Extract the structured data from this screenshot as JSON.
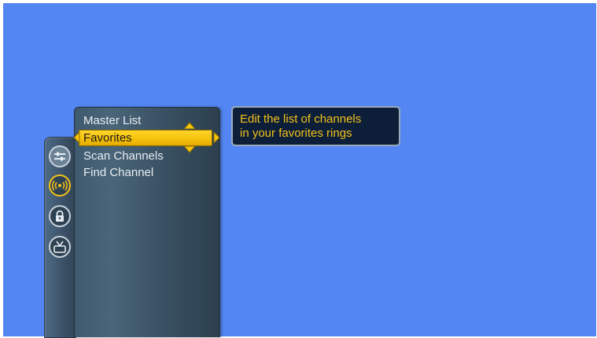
{
  "menu": {
    "items": [
      {
        "label": "Master List",
        "selected": false
      },
      {
        "label": "Favorites",
        "selected": true
      },
      {
        "label": "Scan Channels",
        "selected": false
      },
      {
        "label": "Find Channel",
        "selected": false
      }
    ]
  },
  "rail": {
    "icons": [
      {
        "name": "settings-sliders-icon",
        "active": false
      },
      {
        "name": "broadcast-icon",
        "active": true
      },
      {
        "name": "lock-icon",
        "active": false
      },
      {
        "name": "antenna-tv-icon",
        "active": false
      }
    ]
  },
  "tooltip": {
    "line1": "Edit the list of channels",
    "line2": "in your favorites rings"
  },
  "colors": {
    "background": "#5386f3",
    "highlight": "#f6c20c",
    "tooltip_text": "#f2c21a",
    "tooltip_bg": "#0d1e38"
  }
}
